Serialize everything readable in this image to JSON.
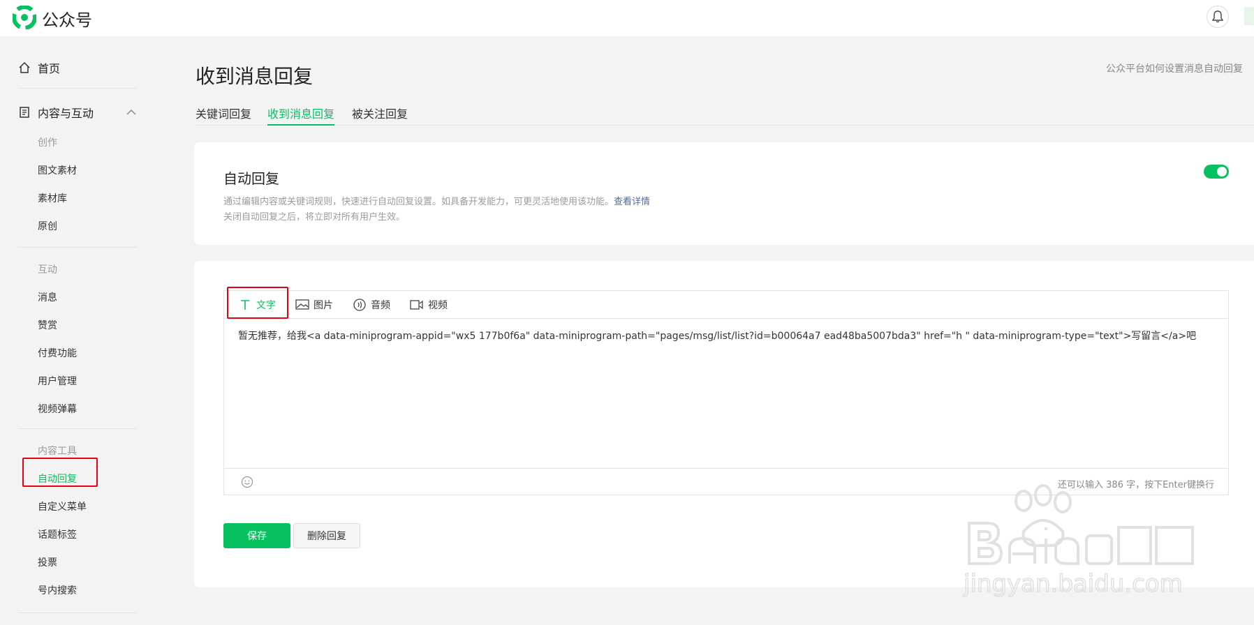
{
  "app": {
    "name": "公众号"
  },
  "sidebar": {
    "home": "首页",
    "group": "内容与互动",
    "sections": [
      {
        "title": "创作",
        "items": [
          "图文素材",
          "素材库",
          "原创"
        ]
      },
      {
        "title": "互动",
        "items": [
          "消息",
          "赞赏",
          "付费功能",
          "用户管理",
          "视频弹幕"
        ]
      },
      {
        "title": "内容工具",
        "items": [
          "自动回复",
          "自定义菜单",
          "话题标签",
          "投票",
          "号内搜索"
        ]
      }
    ],
    "active_item": "自动回复"
  },
  "page": {
    "title": "收到消息回复",
    "help_link": "公众平台如何设置消息自动回复",
    "tabs": [
      "关键词回复",
      "收到消息回复",
      "被关注回复"
    ],
    "active_tab": "收到消息回复"
  },
  "auto_reply": {
    "title": "自动回复",
    "desc_line1": "通过编辑内容或关键词规则，快速进行自动回复设置。如具备开发能力，可更灵活地使用该功能。",
    "desc_link": "查看详情",
    "desc_line2": "关闭自动回复之后，将立即对所有用户生效。",
    "enabled": true
  },
  "editor": {
    "tabs": [
      {
        "label": "文字",
        "icon": "text-icon"
      },
      {
        "label": "图片",
        "icon": "image-icon"
      },
      {
        "label": "音频",
        "icon": "audio-icon"
      },
      {
        "label": "视频",
        "icon": "video-icon"
      }
    ],
    "content": "暂无推荐，给我<a data-miniprogram-appid=\"wx5        177b0f6a\" data-miniprogram-path=\"pages/msg/list/list?id=b00064a7          ead48ba5007bda3\" href=\"h            \" data-miniprogram-type=\"text\">写留言</a>吧",
    "counter": "还可以输入 386 字，按下Enter键换行"
  },
  "buttons": {
    "save": "保存",
    "delete": "删除回复"
  },
  "colors": {
    "accent": "#07c160",
    "highlight": "#e60012",
    "link": "#576b95"
  }
}
